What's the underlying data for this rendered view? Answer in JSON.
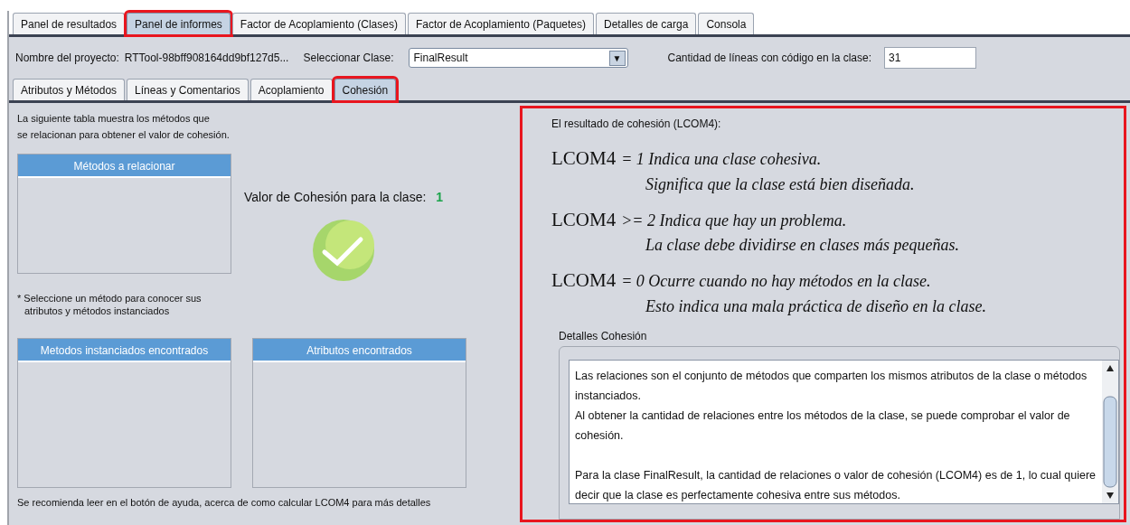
{
  "main_tabs": [
    {
      "label": "Panel de resultados",
      "selected": false,
      "highlighted": false
    },
    {
      "label": "Panel de informes",
      "selected": true,
      "highlighted": true
    },
    {
      "label": "Factor de Acoplamiento (Clases)",
      "selected": false,
      "highlighted": false
    },
    {
      "label": "Factor de Acoplamiento (Paquetes)",
      "selected": false,
      "highlighted": false
    },
    {
      "label": "Detalles de carga",
      "selected": false,
      "highlighted": false
    },
    {
      "label": "Consola",
      "selected": false,
      "highlighted": false
    }
  ],
  "project": {
    "label": "Nombre del proyecto:",
    "value": "RTTool-98bff908164dd9bf127d5..."
  },
  "class_select": {
    "label": "Seleccionar Clase:",
    "value": "FinalResult",
    "arrow": "▼"
  },
  "line_count": {
    "label": "Cantidad de líneas con código en la clase:",
    "value": "31"
  },
  "sub_tabs": [
    {
      "label": "Atributos y Métodos",
      "selected": false,
      "highlighted": false
    },
    {
      "label": "Líneas y Comentarios",
      "selected": false,
      "highlighted": false
    },
    {
      "label": "Acoplamiento",
      "selected": false,
      "highlighted": false
    },
    {
      "label": "Cohesión",
      "selected": true,
      "highlighted": true
    }
  ],
  "left": {
    "intro": [
      "La siguiente tabla muestra los métodos que",
      "se relacionan para obtener el valor de cohesión."
    ],
    "methods_table": {
      "header": "Métodos a relacionar"
    },
    "cohesion_value": {
      "label": "Valor de Cohesión para la clase:",
      "value": "1"
    },
    "hint": [
      "* Seleccione un método para conocer sus",
      "atributos y métodos instanciados"
    ],
    "instantiated_table": {
      "header": "Metodos instanciados encontrados"
    },
    "attributes_table": {
      "header": "Atributos encontrados"
    },
    "footer": "Se recomienda leer en el botón de ayuda, acerca de como calcular LCOM4 para más detalles"
  },
  "right": {
    "highlighted": true,
    "title": "El resultado de cohesión (LCOM4):",
    "rules": [
      {
        "metric": "LCOM4",
        "condition": "= 1",
        "line1": "Indica una clase cohesiva.",
        "line2": "Significa que la clase está bien diseñada."
      },
      {
        "metric": "LCOM4",
        "condition": ">= 2",
        "line1": "Indica que hay un problema.",
        "line2": "La clase debe dividirse en clases más pequeñas."
      },
      {
        "metric": "LCOM4",
        "condition": "= 0",
        "line1": "Ocurre cuando no hay métodos en la clase.",
        "line2": "Esto indica una mala práctica de diseño en la clase."
      }
    ],
    "details": {
      "label": "Detalles Cohesión",
      "groups": [
        [
          "Las relaciones son el conjunto de métodos que comparten los mismos atributos de la clase o métodos instanciados.",
          "Al obtener la cantidad de relaciones entre los métodos de la clase, se puede comprobar el valor de cohesión."
        ],
        [
          "Para la clase FinalResult, la cantidad de relaciones o valor de cohesión (LCOM4) es de 1, lo cual quiere decir que la clase es perfectamente cohesiva entre sus métodos."
        ]
      ]
    }
  }
}
